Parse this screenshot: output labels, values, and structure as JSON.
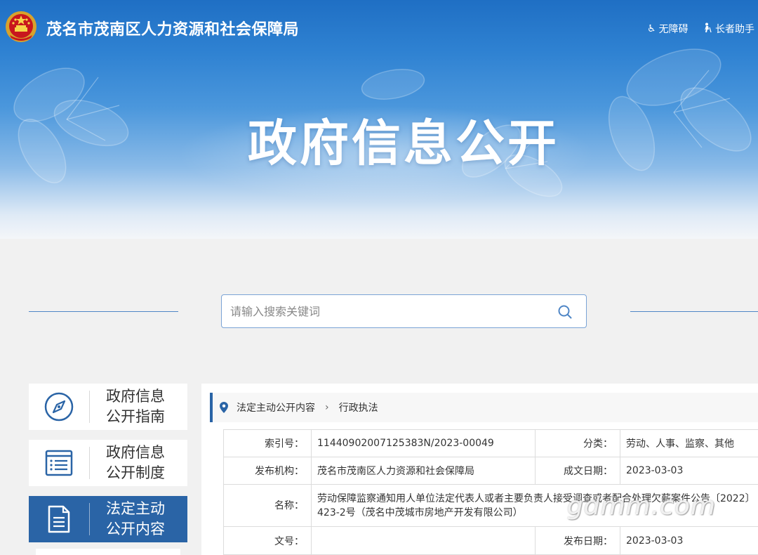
{
  "header": {
    "site_title": "茂名市茂南区人力资源和社会保障局",
    "accessibility_label": "无障碍",
    "elder_label": "长者助手",
    "banner_heading": "政府信息公开"
  },
  "search": {
    "placeholder": "请输入搜索关键词"
  },
  "sidebar": {
    "items": [
      {
        "label_line1": "政府信息",
        "label_line2": "公开指南",
        "icon": "compass-icon",
        "active": false
      },
      {
        "label_line1": "政府信息",
        "label_line2": "公开制度",
        "icon": "list-document-icon",
        "active": false
      },
      {
        "label_line1": "法定主动",
        "label_line2": "公开内容",
        "icon": "document-icon",
        "active": true
      }
    ]
  },
  "breadcrumb": {
    "parent": "法定主动公开内容",
    "current": "行政执法"
  },
  "details": {
    "index_label": "索引号：",
    "index_value": "11440902007125383N/2023-00049",
    "category_label": "分类：",
    "category_value": "劳动、人事、监察、其他",
    "publisher_label": "发布机构：",
    "publisher_value": "茂名市茂南区人力资源和社会保障局",
    "written_date_label": "成文日期：",
    "written_date_value": "2023-03-03",
    "name_label": "名称：",
    "name_value": "劳动保障监察通知用人单位法定代表人或者主要负责人接受调查或者配合处理欠薪案件公告〔2022〕423-2号（茂名中茂城市房地产开发有限公司）",
    "doc_no_label": "文号：",
    "doc_no_value": "",
    "publish_date_label": "发布日期：",
    "publish_date_value": "2023-03-03"
  },
  "watermark": "gdmm.com",
  "colors": {
    "accent": "#2a64a6",
    "banner_top": "#1f6fc4",
    "page_bg": "#f1f1f1"
  }
}
